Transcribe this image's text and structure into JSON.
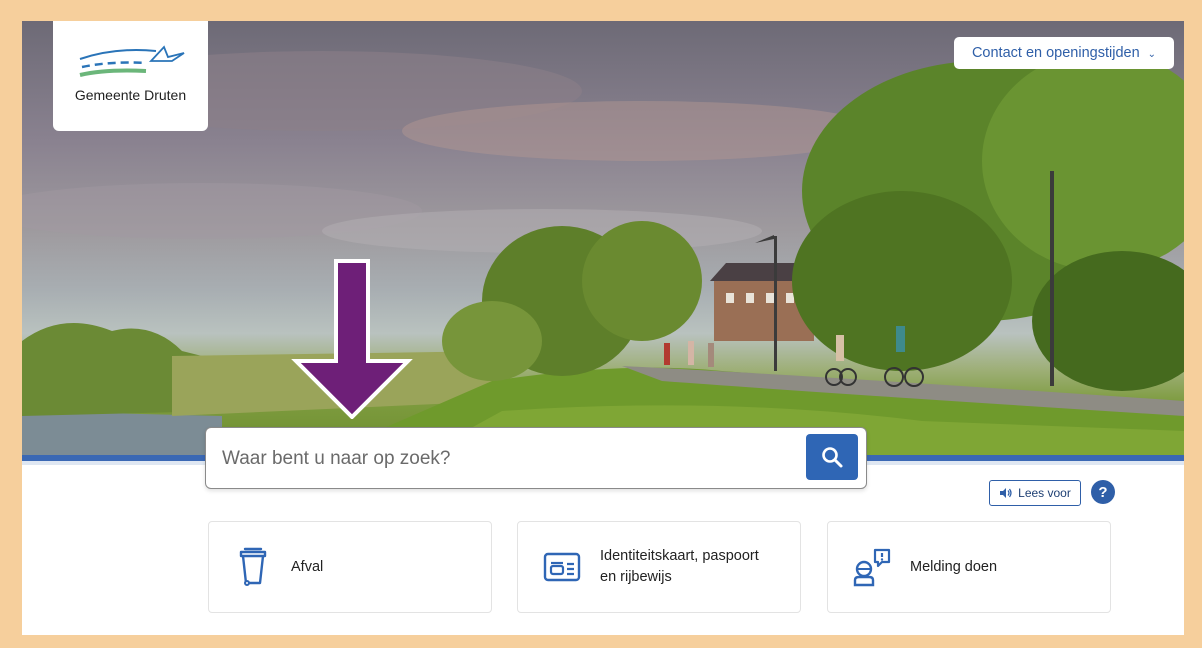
{
  "header": {
    "logo_text": "Gemeente Druten",
    "contact_label": "Contact en openingstijden"
  },
  "search": {
    "placeholder": "Waar bent u naar op zoek?"
  },
  "accessibility": {
    "read_aloud_label": "Lees voor",
    "help_label": "?"
  },
  "tiles": [
    {
      "label": "Afval",
      "icon": "waste-bin-icon"
    },
    {
      "label_line1": "Identiteitskaart, paspoort",
      "label_line2": "en rijbewijs",
      "icon": "id-card-icon"
    },
    {
      "label": "Melding doen",
      "icon": "report-icon"
    }
  ],
  "colors": {
    "brand_blue": "#2f66b5",
    "annotation_arrow": "#6e1f78",
    "page_border": "#f6cf9c"
  }
}
